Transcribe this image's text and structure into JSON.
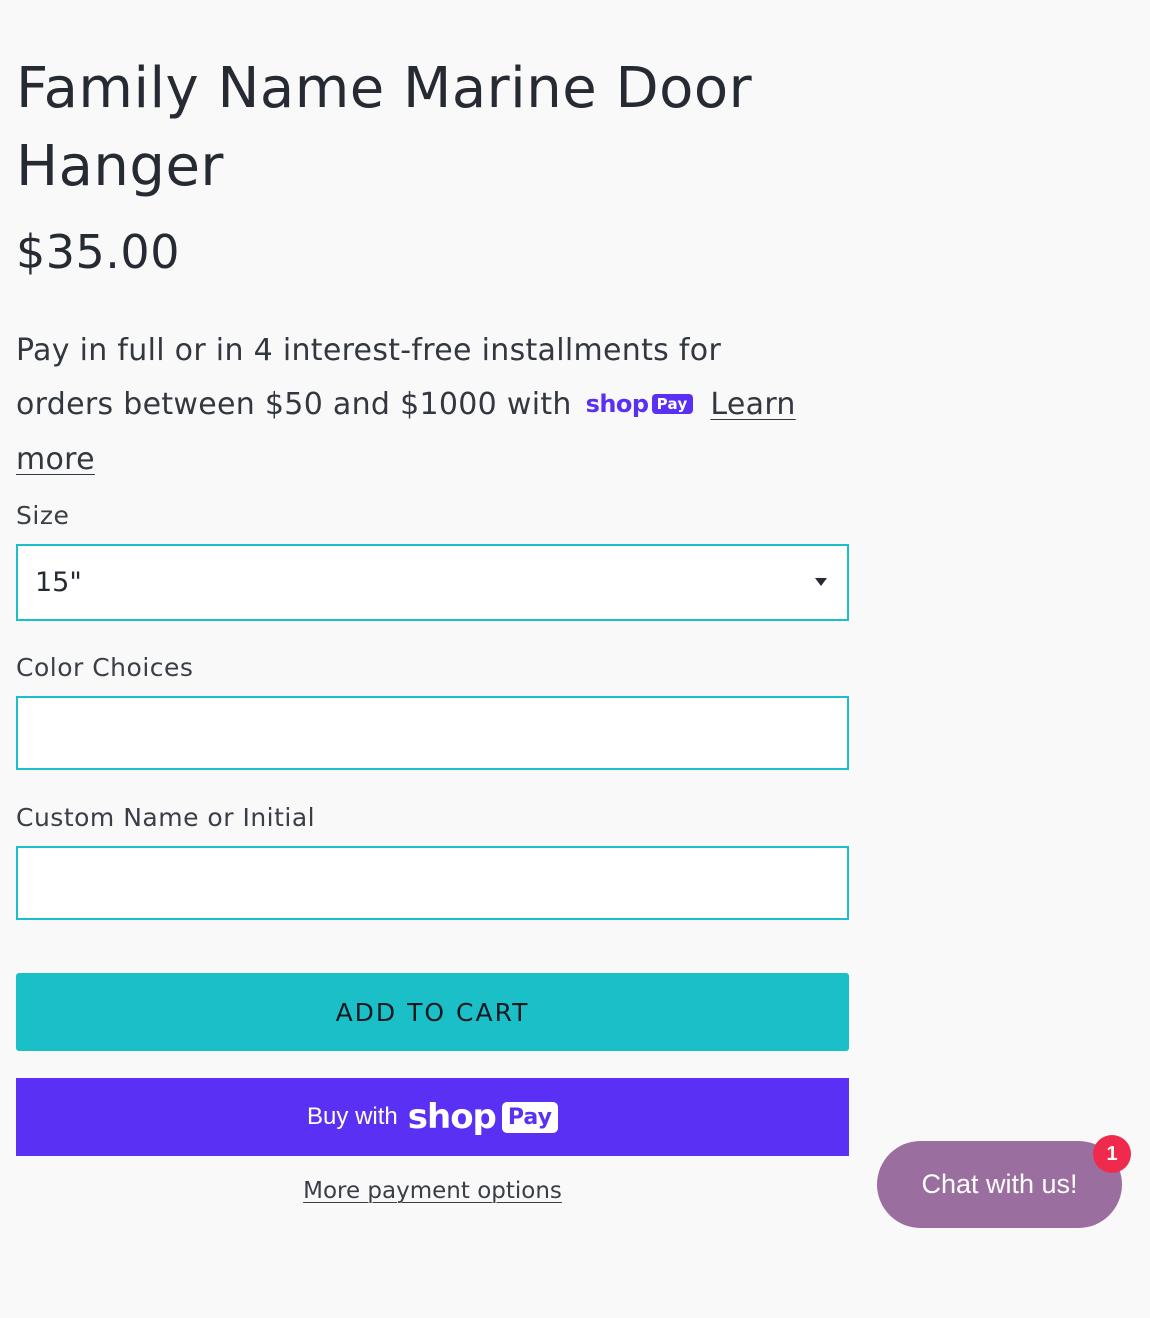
{
  "product": {
    "title": "Family Name Marine Door Hanger",
    "price": "$35.00"
  },
  "installments": {
    "text": "Pay in full or in 4 interest-free installments for orders between $50 and $1000 with",
    "shop_word": "shop",
    "pay_word": "Pay",
    "learn_more": "Learn more"
  },
  "form": {
    "size": {
      "label": "Size",
      "selected": "15\""
    },
    "color": {
      "label": "Color Choices",
      "value": ""
    },
    "custom_name": {
      "label": "Custom Name or Initial",
      "value": ""
    }
  },
  "actions": {
    "add_to_cart": "ADD TO CART",
    "buy_with": "Buy with",
    "shop_word": "shop",
    "pay_word": "Pay",
    "more_payment_options": "More payment options"
  },
  "chat": {
    "label": "Chat with us!",
    "badge_count": "1"
  },
  "colors": {
    "accent": "#1bbfc8",
    "shoppay": "#5a31f4",
    "chat": "#9a6fa0",
    "badge": "#ef2a4c",
    "background": "#f9f9f9"
  }
}
